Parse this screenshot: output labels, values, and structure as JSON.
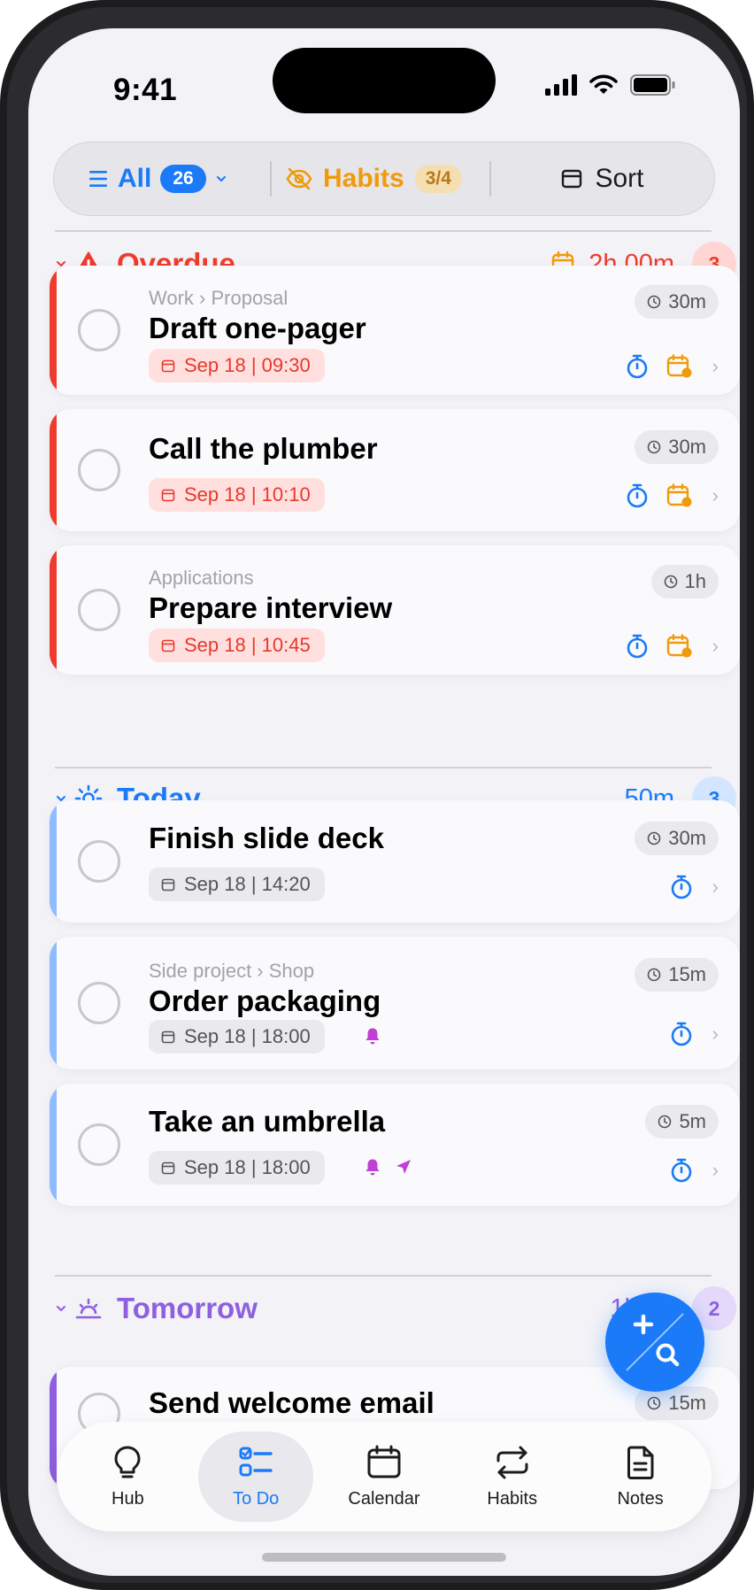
{
  "status": {
    "time": "9:41"
  },
  "filters": {
    "all_label": "All",
    "all_count": "26",
    "habits_label": "Habits",
    "habits_count": "3/4",
    "sort_label": "Sort"
  },
  "sections": {
    "overdue": {
      "title": "Overdue",
      "duration": "2h 00m",
      "count": "3",
      "color": "#ef3b2d"
    },
    "today": {
      "title": "Today",
      "duration": "50m",
      "count": "3",
      "color": "#1a7af8"
    },
    "tomorrow": {
      "title": "Tomorrow",
      "duration": "1h 30",
      "count": "2",
      "color": "#8e5fe0"
    }
  },
  "tasks": [
    {
      "crumb": "Work › Proposal",
      "title": "Draft one-pager",
      "date": "Sep 18 | 09:30",
      "duration": "30m"
    },
    {
      "crumb": "",
      "title": "Call the plumber",
      "date": "Sep 18 | 10:10",
      "duration": "30m"
    },
    {
      "crumb": "Applications",
      "title": "Prepare interview",
      "date": "Sep 18 | 10:45",
      "duration": "1h"
    },
    {
      "crumb": "",
      "title": "Finish slide deck",
      "date": "Sep 18 | 14:20",
      "duration": "30m"
    },
    {
      "crumb": "Side project › Shop",
      "title": "Order packaging",
      "date": "Sep 18 | 18:00",
      "duration": "15m"
    },
    {
      "crumb": "",
      "title": "Take an umbrella",
      "date": "Sep 18 | 18:00",
      "duration": "5m"
    },
    {
      "crumb": "",
      "title": "Send welcome email",
      "date": "",
      "duration": "15m"
    }
  ],
  "tabs": [
    {
      "label": "Hub",
      "icon": "lightbulb-icon"
    },
    {
      "label": "To Do",
      "icon": "checklist-icon"
    },
    {
      "label": "Calendar",
      "icon": "calendar-icon"
    },
    {
      "label": "Habits",
      "icon": "repeat-icon"
    },
    {
      "label": "Notes",
      "icon": "document-icon"
    }
  ],
  "colors": {
    "accent": "#1a7af8",
    "overdue": "#ef3b2d",
    "habit": "#f09a0b",
    "today_stripe": "#8fbcff",
    "tomorrow_stripe": "#8e5fe0",
    "reminder": "#c040d6"
  }
}
